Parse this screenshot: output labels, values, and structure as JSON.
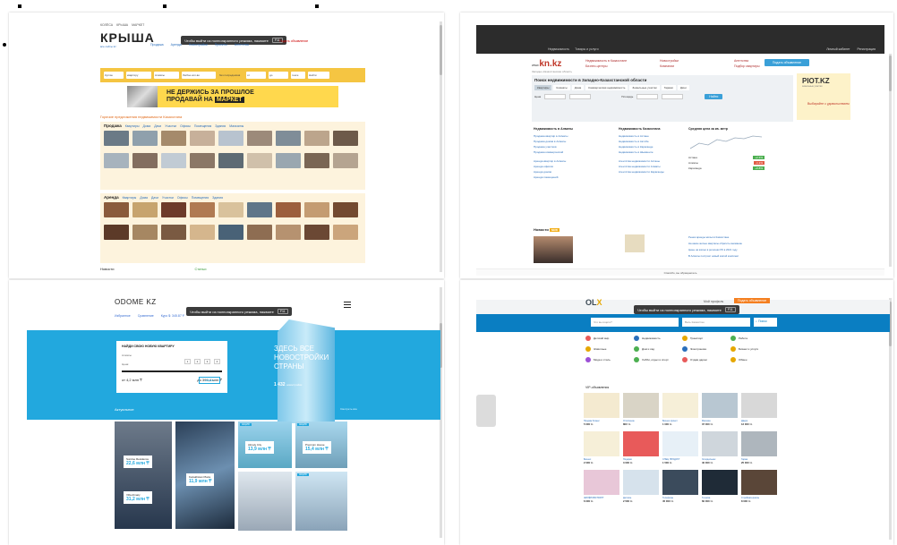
{
  "incognito_notice": {
    "text": "Чтобы выйти из полноэкранного режима, нажмите",
    "key": "F11"
  },
  "krisha": {
    "topnav": [
      "КОЛЁСА",
      "КРЫША",
      "МАРКЕТ"
    ],
    "logo": "КРЫША",
    "sublogo": "все сайты kz",
    "menu": [
      "Продажа",
      "Аренда",
      "Новостройки",
      "Проекты",
      "Агентства"
    ],
    "right_link": "Подать объявление",
    "search_fields": [
      "Куплю",
      "квартиру",
      "Алматы",
      "Любое кол-во",
      "без посредников",
      "от",
      "до",
      "тенге",
      "Найти"
    ],
    "banner_line1": "НЕ ДЕРЖИСЬ ЗА ПРОШЛОЕ",
    "banner_line2": "ПРОДАВАЙ НА",
    "banner_brand": "МАРКЕТ",
    "heading": "Горячие предложения недвижимости Казахстана",
    "sale_title": "Продажа",
    "sale_links": [
      "Квартиры",
      "Дома",
      "Дачи",
      "Участки",
      "Офисы",
      "Помещения",
      "Здания",
      "Магазины"
    ],
    "rent_title": "Аренда",
    "rent_links": [
      "Квартиры",
      "Дома",
      "Дачи",
      "Участки",
      "Офисы",
      "Помещения",
      "Здания"
    ],
    "news_label": "Новости",
    "articles_label": "Статьи"
  },
  "knkz": {
    "dark_nav": [
      "Недвижимость",
      "Товары и услуги"
    ],
    "dark_right": [
      "Личный кабинет",
      "Регистрация"
    ],
    "logo_prefix": "www.",
    "logo_main": "kn.kz",
    "tagline": "Западно-Казахстанская область",
    "links": [
      "Недвижимость в Казахстане",
      "Новостройки",
      "Агентства",
      "Бизнес-центры",
      "Компании",
      "Подбор квартиры"
    ],
    "add_button": "Подать объявление",
    "form_title": "Поиск недвижимости в Западно-Казахстанской области",
    "tabs": [
      "Квартиры",
      "Комнаты",
      "Дома",
      "Коммерческая недвижимость",
      "Земельные участки",
      "Гаражи",
      "Дачи"
    ],
    "price_label": "Цена",
    "area_label": "Площадь",
    "find": "Найти",
    "ad_brand": "PIOT.KZ",
    "ad_sub": "земельные участки",
    "ad_cta": "Выбирайте с удовольствием",
    "col1_title": "Недвижимость в Алматы",
    "col1_links": [
      "Продажа квартир в Алматы",
      "Продажа домов в Алматы",
      "Продажа участков",
      "Продажа коммерческой",
      "Аренда квартир в Алматы",
      "Аренда офисов",
      "Аренда домов",
      "Аренда помещений"
    ],
    "col2_title": "Недвижимость Казахстана",
    "col2_links": [
      "Недвижимость в Астане",
      "Недвижимость в Актобе",
      "Недвижимость в Караганде",
      "Недвижимость в Шымкенте",
      "Агентства недвижимости Астаны",
      "Агентства недвижимости Алматы",
      "Агентства недвижимости Караганды"
    ],
    "price_title": "Средняя цена за кв. метр",
    "price_rows": [
      [
        "Астана",
        "+2.3%"
      ],
      [
        "Алматы",
        "-1.1%"
      ],
      [
        "Караганда",
        "+0.8%"
      ]
    ],
    "news_title": "Новости",
    "news_tag": "NEW",
    "news_items": [
      "Рынок аренды жилья в Казахстане",
      "На какие жилые кварталы обратить внимание",
      "Цены на жильё в регионах РК в 2021 году",
      "В Алматы построят новый жилой комплекс"
    ],
    "bottom_text": "Спасибо, вы обращаетесь"
  },
  "odome": {
    "logo": "ODOME",
    "logo_suffix": "KZ",
    "sub_links": [
      "Избранное",
      "Сравнение",
      "Курс $: 345.87 ₸"
    ],
    "card_title": "НАЙДИ СВОЮ НОВУЮ КВАРТИРУ",
    "city": "Алматы",
    "rooms_label": "Комнаты",
    "rooms": [
      "1",
      "2",
      "3",
      "4"
    ],
    "price_label": "Цена:",
    "price_from": "от 4,2 млн ₸",
    "price_to": "до 399,4 млн ₸",
    "search_btn": "Искать",
    "slogan": "ЗДЕСЬ ВСЕ НОВОСТРОЙКИ СТРАНЫ",
    "count": "1 432",
    "count_label": "новостройки",
    "actual": "Актуальное",
    "all": "Смотреть все",
    "tiles": [
      {
        "name": "Sunrise Residence",
        "price": "22,6 млн ₸"
      },
      {
        "name": "Kazakhstan Plaza",
        "price": "11,9 млн ₸"
      },
      {
        "name": "Almaty City",
        "price": "13,9 млн ₸"
      },
      {
        "name": "Premium House",
        "price": "15,4 млн ₸"
      },
      {
        "name": "Villa Almaty",
        "price": "31,2 млн ₸"
      }
    ]
  },
  "olx": {
    "logo_o": "O",
    "logo_l": "L",
    "logo_x": "X",
    "account": "Мой профиль",
    "post": "Подать объявление",
    "search_placeholder": "Что вы ищете?",
    "location": "Весь Казахстан",
    "search_btn": "Поиск",
    "categories": [
      "Детский мир",
      "Недвижимость",
      "Транспорт",
      "Работа",
      "Животные",
      "Дом и сад",
      "Электроника",
      "Бизнес и услуги",
      "Мода и стиль",
      "Хобби, отдых и спорт",
      "Отдам даром",
      "Обмен"
    ],
    "vip_label": "VIP-объявления",
    "items": [
      {
        "title": "Продам бизнес",
        "price": "5 000 тг."
      },
      {
        "title": "Отопление",
        "price": "800 тг."
      },
      {
        "title": "Бизнес-проект",
        "price": "1 000 тг."
      },
      {
        "title": "Магазин",
        "price": "37 000 тг."
      },
      {
        "title": "Двери",
        "price": "12 000 тг."
      },
      {
        "title": "Бизнес",
        "price": "2 000 тг."
      },
      {
        "title": "Подарки",
        "price": "3 000 тг."
      },
      {
        "title": "СПЕЦ ПРОДУКТ",
        "price": "1 500 тг."
      },
      {
        "title": "Холодильник",
        "price": "40 000 тг."
      },
      {
        "title": "Гараж",
        "price": "25 000 тг."
      },
      {
        "title": "ЖИЛЁНОВСТРАНТ",
        "price": "6 000 тг."
      },
      {
        "title": "Детские",
        "price": "2 500 тг."
      },
      {
        "title": "Телефоны",
        "price": "45 000 тг."
      },
      {
        "title": "Техника",
        "price": "60 000 тг."
      },
      {
        "title": "Стройматериалы",
        "price": "8 000 тг."
      }
    ]
  }
}
